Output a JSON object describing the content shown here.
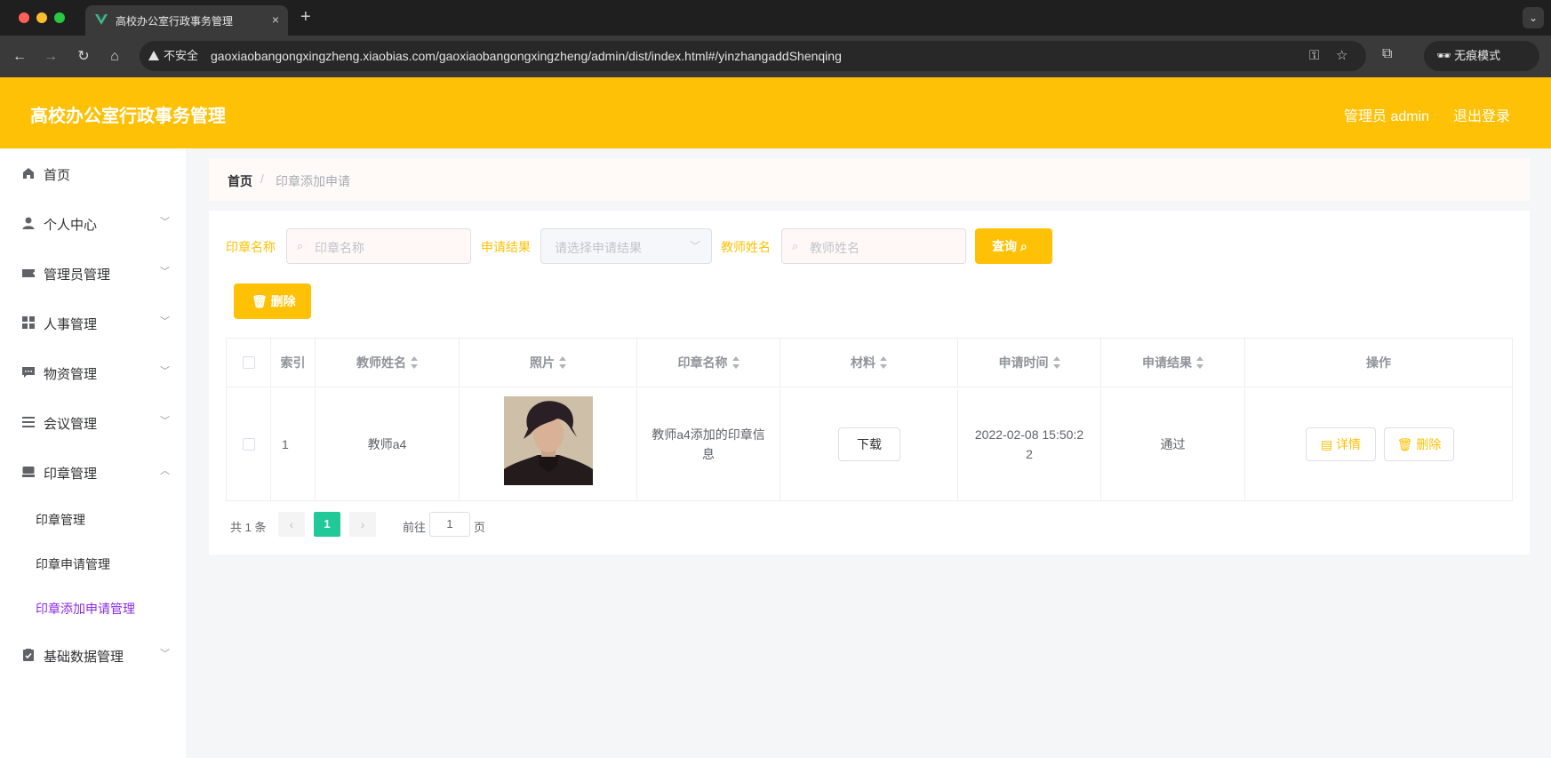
{
  "browser": {
    "tab_title": "高校办公室行政事务管理",
    "new_tab": "+",
    "close": "×",
    "insecure_label": "不安全",
    "url": "gaoxiaobangongxingzheng.xiaobias.com/gaoxiaobangongxingzheng/admin/dist/index.html#/yinzhangaddShenqing",
    "incognito_label": "无痕模式"
  },
  "header": {
    "title": "高校办公室行政事务管理",
    "user": "管理员 admin",
    "logout": "退出登录",
    "brand_color": "#ffc105"
  },
  "sidebar": {
    "items": [
      {
        "label": "首页",
        "icon": "home-icon"
      },
      {
        "label": "个人中心",
        "icon": "user-icon"
      },
      {
        "label": "管理员管理",
        "icon": "ticket-icon"
      },
      {
        "label": "人事管理",
        "icon": "grid-icon"
      },
      {
        "label": "物资管理",
        "icon": "message-icon"
      },
      {
        "label": "会议管理",
        "icon": "list-icon"
      },
      {
        "label": "印章管理",
        "icon": "stamp-icon"
      },
      {
        "label": "基础数据管理",
        "icon": "clipboard-icon"
      }
    ],
    "subitems": [
      {
        "label": "印章管理"
      },
      {
        "label": "印章申请管理"
      },
      {
        "label": "印章添加申请管理",
        "active": true
      }
    ],
    "active_color": "#8a2be2"
  },
  "breadcrumb": {
    "home": "首页",
    "separator": "/",
    "current": "印章添加申请"
  },
  "search": {
    "seal_name_label": "印章名称",
    "seal_name_placeholder": "印章名称",
    "result_label": "申请结果",
    "result_placeholder": "请选择申请结果",
    "teacher_label": "教师姓名",
    "teacher_placeholder": "教师姓名",
    "query_button": "查询"
  },
  "actions": {
    "delete_button": "删除"
  },
  "table": {
    "headers": {
      "index": "索引",
      "teacher": "教师姓名",
      "photo": "照片",
      "seal_name": "印章名称",
      "material": "材料",
      "time": "申请时间",
      "result": "申请结果",
      "operation": "操作"
    },
    "rows": [
      {
        "index": "1",
        "teacher": "教师a4",
        "seal_name_line1": "教师a4添加的印章信",
        "seal_name_line2": "息",
        "download": "下载",
        "time_line1": "2022-02-08 15:50:2",
        "time_line2": "2",
        "result": "通过",
        "detail": "详情",
        "delete": "删除"
      }
    ]
  },
  "pagination": {
    "total": "共 1 条",
    "current_page": "1",
    "goto_label": "前往",
    "goto_value": "1",
    "page_suffix": "页"
  }
}
